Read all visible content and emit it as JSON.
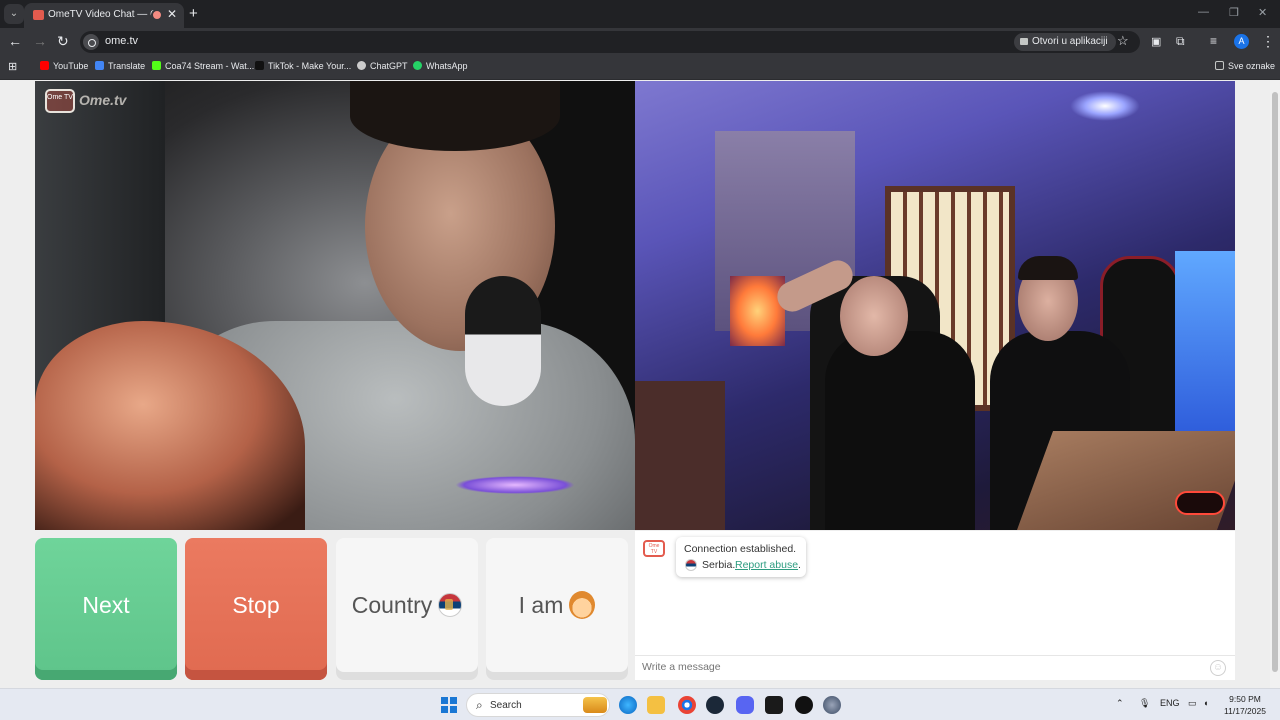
{
  "browser": {
    "tab_title": "OmeTV Video Chat — Omegle",
    "url": "ome.tv",
    "open_in_app_label": "Otvori u aplikaciji",
    "profile_initial": "A",
    "bookmarks": [
      {
        "label": "YouTube",
        "color": "#ff0000"
      },
      {
        "label": "Translate",
        "color": "#4285f4"
      },
      {
        "label": "Coa74 Stream - Wat...",
        "color": "#53fc18"
      },
      {
        "label": "TikTok - Make Your...",
        "color": "#111111"
      },
      {
        "label": "ChatGPT",
        "color": "#cccccc"
      },
      {
        "label": "WhatsApp",
        "color": "#25d366"
      }
    ],
    "all_bookmarks_label": "Sve oznake"
  },
  "site": {
    "logo_text": "Ome.tv",
    "logo_badge": "Ome TV"
  },
  "controls": {
    "next_label": "Next",
    "stop_label": "Stop",
    "country_label": "Country",
    "iam_label": "I am"
  },
  "chat": {
    "status_message": "Connection established.",
    "partner_country": "Serbia.",
    "report_link": "Report abuse",
    "report_suffix": ".",
    "input_placeholder": "Write a message"
  },
  "taskbar": {
    "search_placeholder": "Search",
    "language": "ENG",
    "time": "9:50 PM",
    "date": "11/17/2025"
  },
  "colors": {
    "next": "#5ec48a",
    "stop": "#e06a50",
    "link": "#2d9c80"
  }
}
